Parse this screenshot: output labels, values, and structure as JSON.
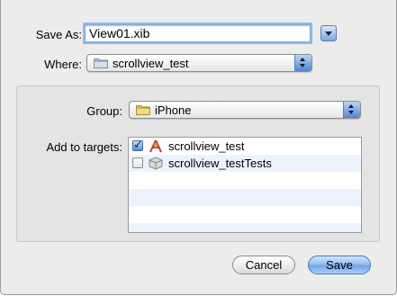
{
  "save_as": {
    "label": "Save As:",
    "value": "View01.xib"
  },
  "where": {
    "label": "Where:",
    "value": "scrollview_test"
  },
  "group": {
    "label": "Group:",
    "value": "iPhone"
  },
  "targets": {
    "label": "Add to targets:",
    "items": [
      {
        "name": "scrollview_test",
        "checked": true,
        "icon": "app-target-icon"
      },
      {
        "name": "scrollview_testTests",
        "checked": false,
        "icon": "test-bundle-icon"
      }
    ]
  },
  "buttons": {
    "cancel": "Cancel",
    "save": "Save"
  },
  "colors": {
    "accent": "#6fa3e4",
    "focus_ring": "#8fbbea",
    "row_alt": "#edf3fe"
  }
}
